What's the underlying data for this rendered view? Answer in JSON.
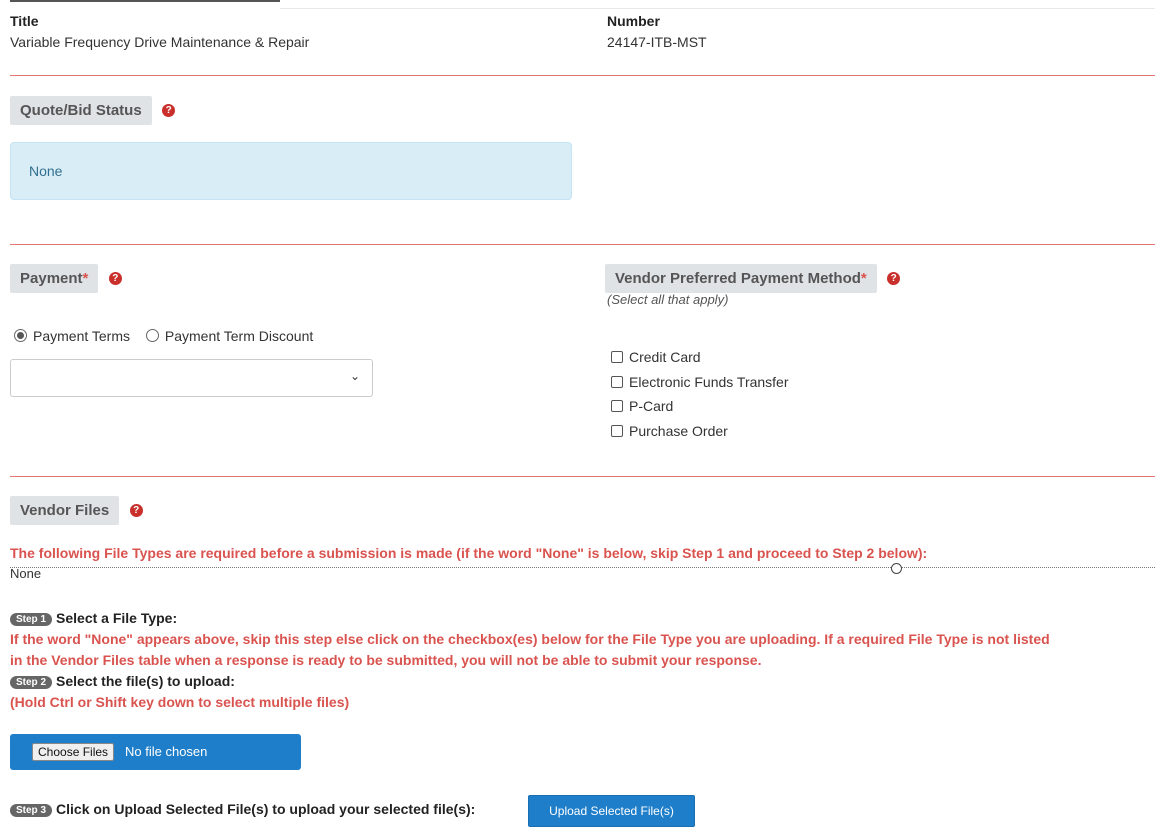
{
  "header": {
    "title_label": "Title",
    "title_value": "Variable Frequency Drive Maintenance & Repair",
    "number_label": "Number",
    "number_value": "24147-ITB-MST"
  },
  "quote_bid": {
    "heading": "Quote/Bid Status",
    "help_icon": "?",
    "status_value": "None"
  },
  "payment": {
    "heading": "Payment",
    "required_mark": "*",
    "help_icon": "?",
    "radio_options": [
      {
        "label": "Payment Terms",
        "selected": true
      },
      {
        "label": "Payment Term Discount",
        "selected": false
      }
    ],
    "select_value": "",
    "select_icon": "chevron-down-icon"
  },
  "vendor_payment": {
    "heading": "Vendor Preferred Payment Method",
    "required_mark": "*",
    "help_icon": "?",
    "subtitle": "(Select all that apply)",
    "options": [
      {
        "label": "Credit Card",
        "checked": false
      },
      {
        "label": "Electronic Funds Transfer",
        "checked": false
      },
      {
        "label": "P-Card",
        "checked": false
      },
      {
        "label": "Purchase Order",
        "checked": false
      }
    ]
  },
  "vendor_files": {
    "heading": "Vendor Files",
    "help_icon": "?",
    "required_types_text": "The following File Types are required before a submission is made (if the word \"None\" is below, skip Step 1 and proceed to Step 2 below):",
    "required_types_value": "None",
    "step1_badge": "Step 1",
    "step1_title": "Select a File Type:",
    "step1_instructions_line1": "If the word \"None\" appears above, skip this step else click on the checkbox(es) below for the File Type you are uploading. If a required File Type is not listed",
    "step1_instructions_line2": "in the Vendor Files table when a response is ready to be submitted, you will not be able to submit your response.",
    "step2_badge": "Step 2",
    "step2_title": "Select the file(s) to upload:",
    "step2_hint": "(Hold Ctrl or Shift key down to select multiple files)",
    "choose_files_label": "Choose Files",
    "no_file_text": "No file chosen",
    "step3_badge": "Step 3",
    "step3_title": "Click on Upload Selected File(s) to upload your selected file(s):",
    "upload_button_label": "Upload Selected File(s)"
  },
  "colors": {
    "accent_red": "#d9534f",
    "primary_blue": "#1f7ec9",
    "info_bg": "#d9edf7"
  }
}
